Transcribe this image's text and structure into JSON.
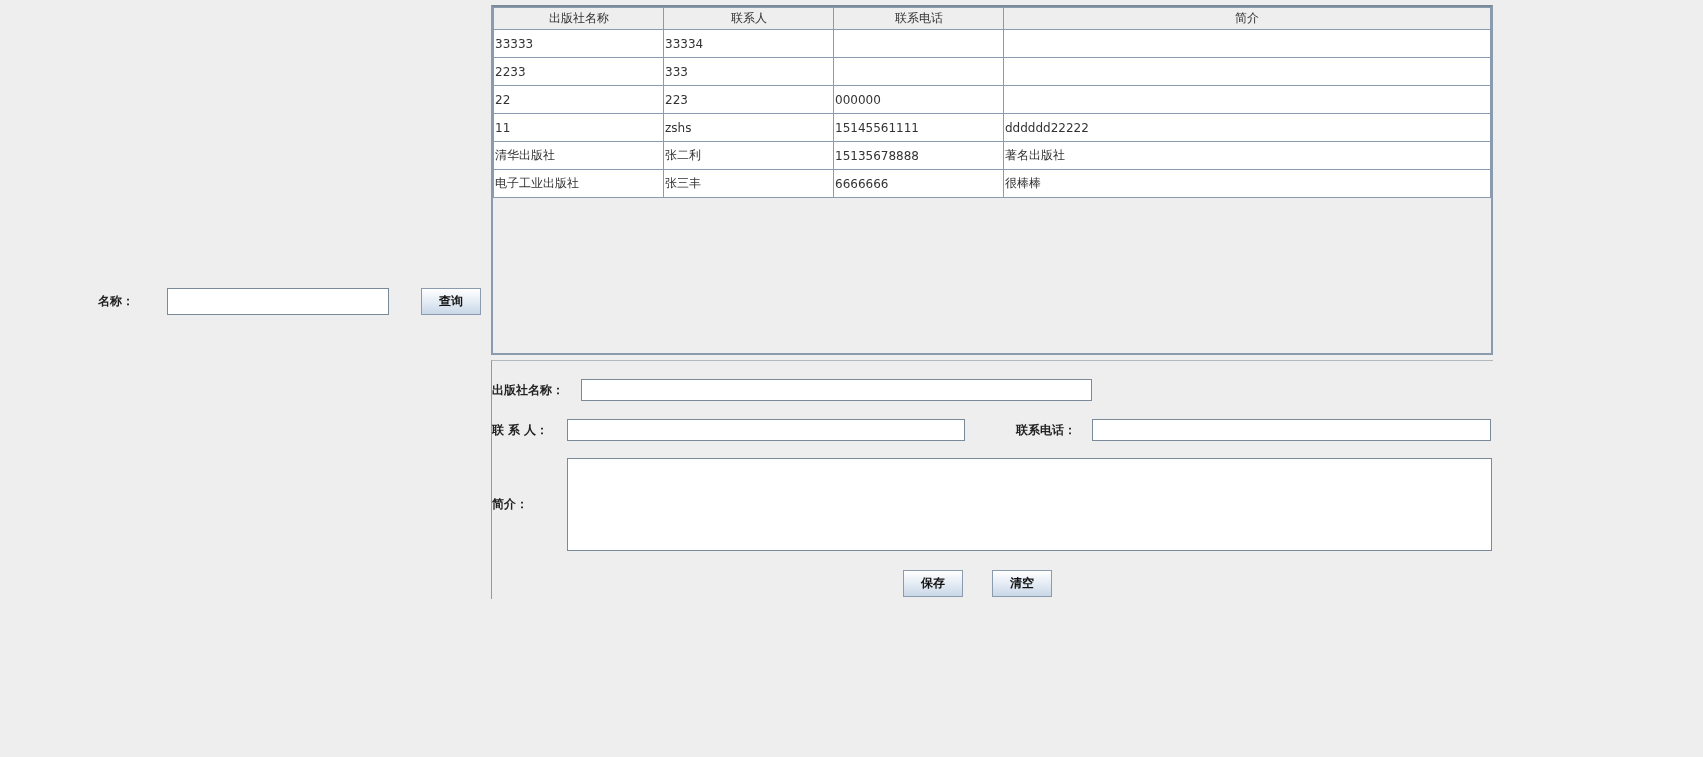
{
  "search": {
    "label": "名称：",
    "button": "查询"
  },
  "table": {
    "columns": [
      "出版社名称",
      "联系人",
      "联系电话",
      "简介"
    ],
    "rows": [
      [
        "33333",
        "33334",
        null,
        null
      ],
      [
        "2233",
        "333",
        null,
        null
      ],
      [
        "22",
        "223",
        "000000",
        null
      ],
      [
        "11",
        "zshs",
        "15145561111",
        "dddddd22222"
      ],
      [
        "清华出版社",
        "张二利",
        "15135678888",
        "著名出版社"
      ],
      [
        "电子工业出版社",
        "张三丰",
        "6666666",
        "很棒棒"
      ]
    ]
  },
  "form": {
    "name_label": "出版社名称：",
    "contact_label": "联 系 人：",
    "phone_label": "联系电话：",
    "intro_label": "简介：",
    "buttons": [
      "保存",
      "清空"
    ]
  }
}
